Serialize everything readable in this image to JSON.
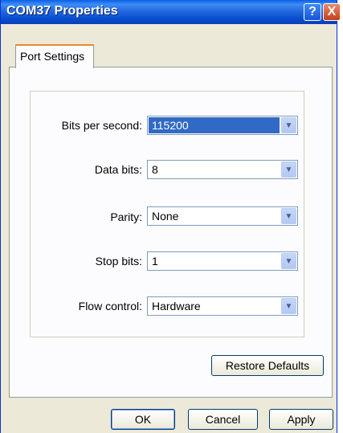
{
  "window": {
    "title": "COM37 Properties",
    "help_glyph": "?",
    "close_glyph": "X"
  },
  "tabs": [
    {
      "label": "Port Settings",
      "active": true
    }
  ],
  "fields": [
    {
      "label": "Bits per second:",
      "value": "115200",
      "selected": true
    },
    {
      "label": "Data bits:",
      "value": "8"
    },
    {
      "label": "Parity:",
      "value": "None"
    },
    {
      "label": "Stop bits:",
      "value": "1"
    },
    {
      "label": "Flow control:",
      "value": "Hardware"
    }
  ],
  "buttons": {
    "restore": "Restore Defaults",
    "ok": "OK",
    "cancel": "Cancel",
    "apply": "Apply"
  },
  "icons": {
    "dropdown": "chevron-down-icon"
  },
  "colors": {
    "titlebar": "#0a4fd0",
    "selection": "#316ac5",
    "tab_accent": "#e68b2c"
  }
}
